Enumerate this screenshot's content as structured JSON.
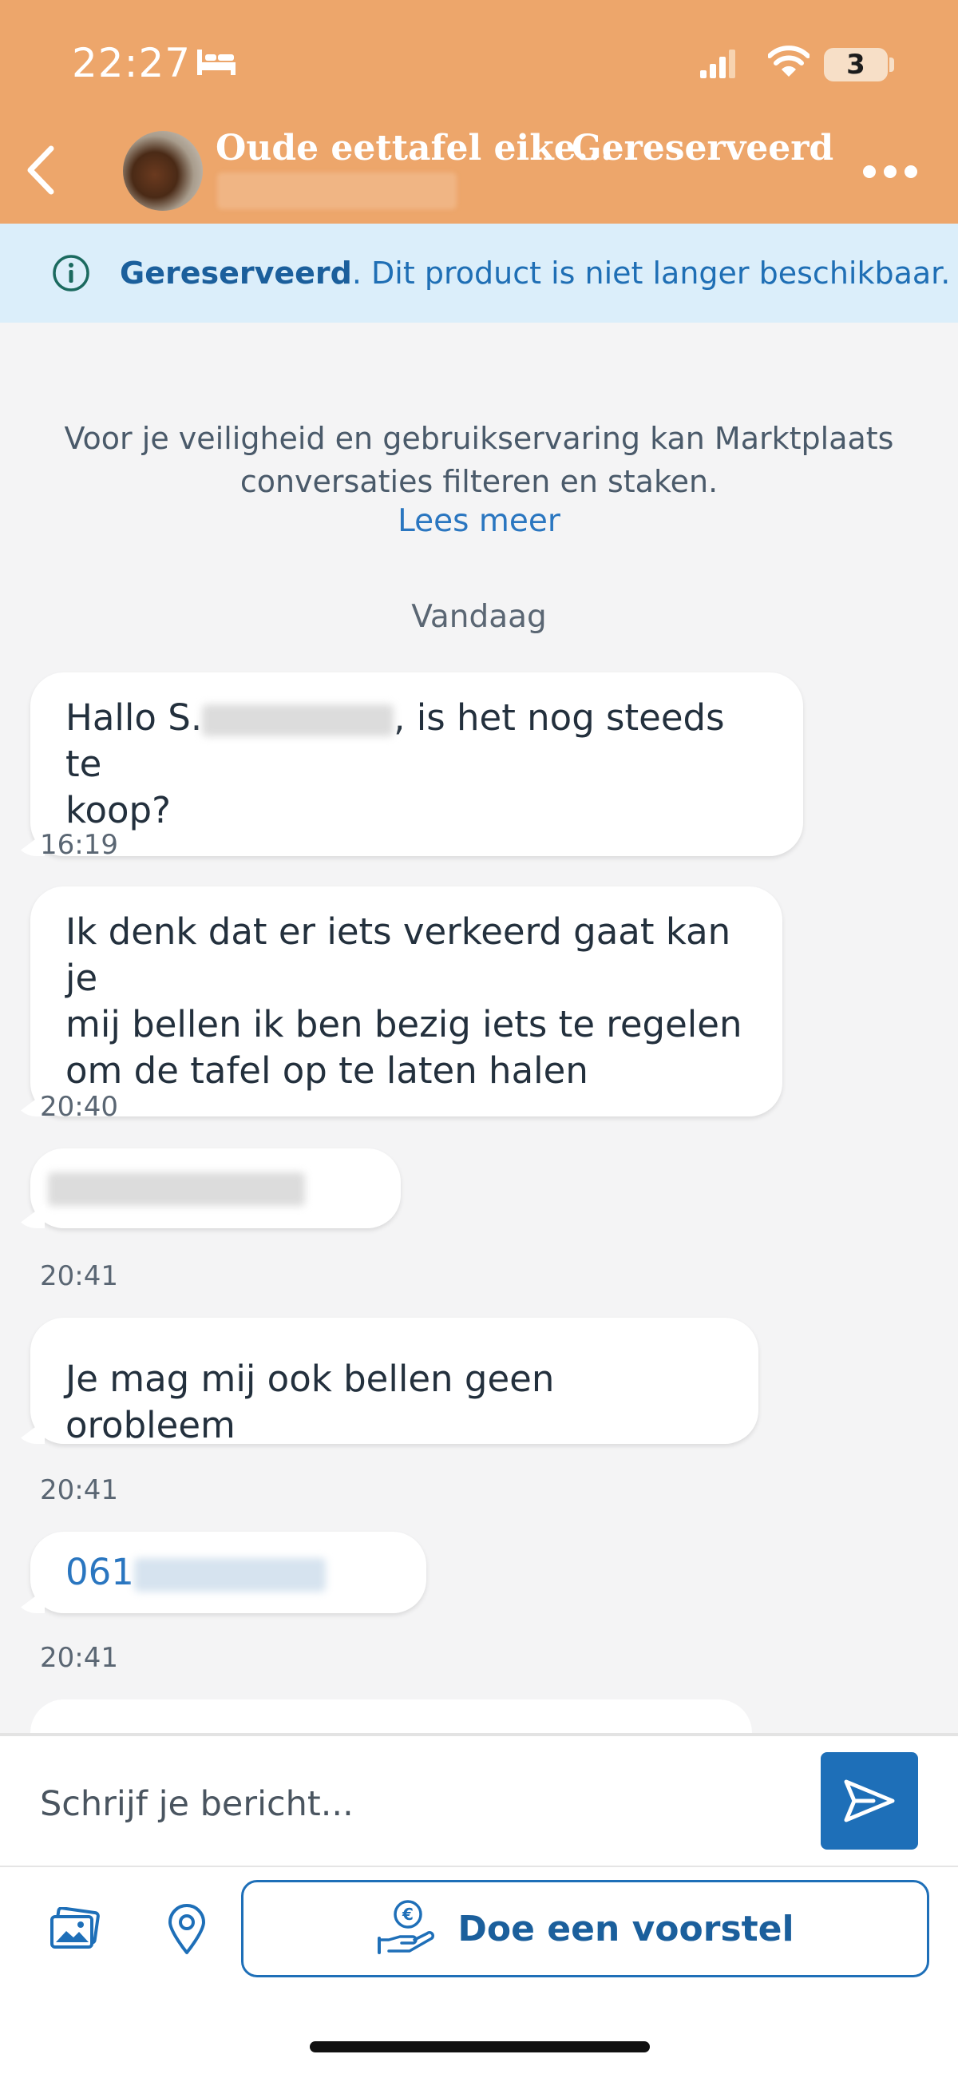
{
  "status_bar": {
    "time": "22:27",
    "battery": "3"
  },
  "header": {
    "listing_title": "Oude eettafel eike...",
    "listing_status": "Gereserveerd"
  },
  "banner": {
    "status": "Gereserveerd",
    "message": ". Dit product is niet langer beschikbaar."
  },
  "notice": {
    "line1": "Voor je veiligheid en gebruikservaring kan Marktplaats",
    "line2": "conversaties filteren en staken.",
    "link": "Lees meer"
  },
  "date_separator": "Vandaag",
  "messages": [
    {
      "before": "Hallo S.",
      "after": ", is het nog steeds te",
      "line2": "koop?",
      "time": "16:19"
    },
    {
      "line1": "Ik denk dat er iets verkeerd gaat  kan je",
      "line2": "mij bellen ik ben bezig iets te regelen",
      "line3": "om de tafel op te laten halen",
      "time": "20:40"
    },
    {
      "time": "20:41"
    },
    {
      "text": "Je mag mij ook bellen geen orobleem",
      "time": "20:41"
    },
    {
      "text": "061",
      "time": "20:41"
    }
  ],
  "composer": {
    "placeholder": "Schrijf je bericht..."
  },
  "toolbar": {
    "offer_label": "Doe een voorstel"
  },
  "icons": {
    "back": "chevron-left-icon",
    "more": "more-dots-icon",
    "info": "info-icon",
    "send": "send-icon",
    "photo": "photo-icon",
    "location": "location-pin-icon",
    "offer": "euro-hand-icon"
  },
  "colors": {
    "header": "#eda66b",
    "banner": "#dbeefa",
    "accent": "#1e6fb8"
  }
}
